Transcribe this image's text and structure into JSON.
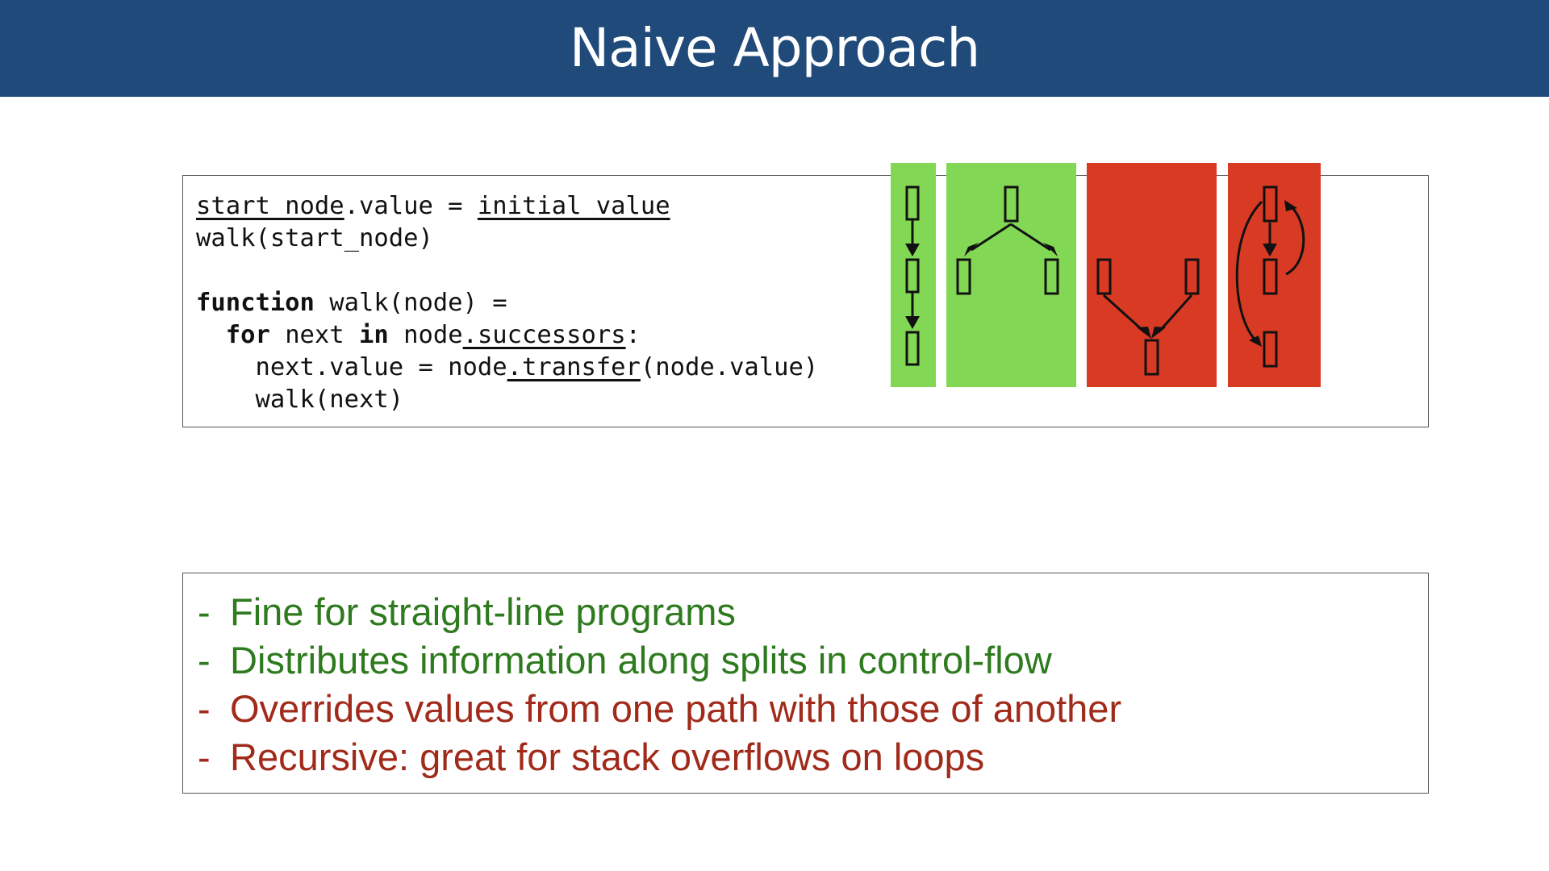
{
  "title": "Naive Approach",
  "code": [
    [
      {
        "t": "start_node",
        "u": true
      },
      {
        "t": ".value = "
      },
      {
        "t": "initial_value",
        "u": true
      }
    ],
    [
      {
        "t": "walk(start_node)"
      }
    ],
    [],
    [
      {
        "t": "function",
        "b": true
      },
      {
        "t": " walk(node) ="
      }
    ],
    [
      {
        "t": "  "
      },
      {
        "t": "for",
        "b": true
      },
      {
        "t": " next "
      },
      {
        "t": "in",
        "b": true
      },
      {
        "t": " node"
      },
      {
        "t": ".successors",
        "u": true
      },
      {
        "t": ":"
      }
    ],
    [
      {
        "t": "    next.value = node"
      },
      {
        "t": ".transfer",
        "u": true
      },
      {
        "t": "(node.value)"
      }
    ],
    [
      {
        "t": "    walk(next)"
      }
    ]
  ],
  "diagrams": [
    {
      "kind": "straight-line",
      "color": "#82d854"
    },
    {
      "kind": "split",
      "color": "#82d854"
    },
    {
      "kind": "merge",
      "color": "#d93a24"
    },
    {
      "kind": "loop",
      "color": "#d93a24"
    }
  ],
  "bullets": [
    {
      "text": "Fine for straight-line programs",
      "color": "#2e7a1e"
    },
    {
      "text": "Distributes information along splits in control-flow",
      "color": "#2e7a1e"
    },
    {
      "text": "Overrides values from one path with those of another",
      "color": "#a12a1a"
    },
    {
      "text": "Recursive: great for stack overflows on loops",
      "color": "#a12a1a"
    }
  ],
  "bullet_marker": "-",
  "colors": {
    "title_bar": "#1f4a7a",
    "title_text": "#ffffff",
    "good": "#2e7a1e",
    "bad": "#a12a1a"
  }
}
